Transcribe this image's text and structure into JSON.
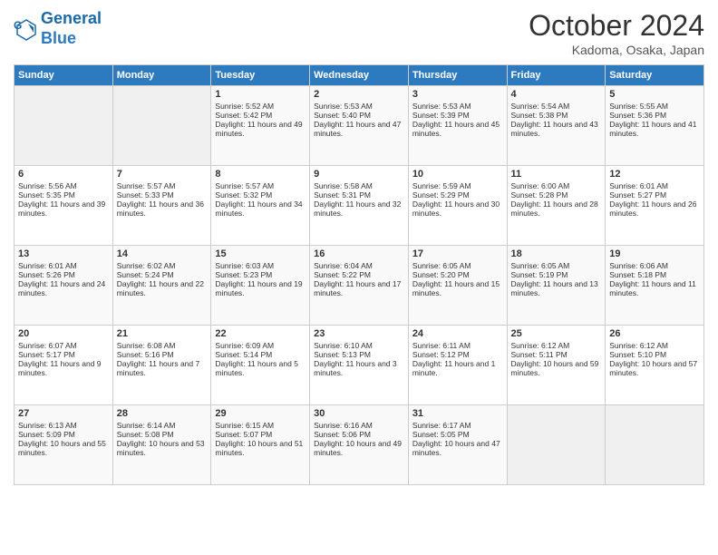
{
  "header": {
    "logo_line1": "General",
    "logo_line2": "Blue",
    "month": "October 2024",
    "location": "Kadoma, Osaka, Japan"
  },
  "weekdays": [
    "Sunday",
    "Monday",
    "Tuesday",
    "Wednesday",
    "Thursday",
    "Friday",
    "Saturday"
  ],
  "weeks": [
    [
      {
        "day": "",
        "sunrise": "",
        "sunset": "",
        "daylight": ""
      },
      {
        "day": "",
        "sunrise": "",
        "sunset": "",
        "daylight": ""
      },
      {
        "day": "1",
        "sunrise": "Sunrise: 5:52 AM",
        "sunset": "Sunset: 5:42 PM",
        "daylight": "Daylight: 11 hours and 49 minutes."
      },
      {
        "day": "2",
        "sunrise": "Sunrise: 5:53 AM",
        "sunset": "Sunset: 5:40 PM",
        "daylight": "Daylight: 11 hours and 47 minutes."
      },
      {
        "day": "3",
        "sunrise": "Sunrise: 5:53 AM",
        "sunset": "Sunset: 5:39 PM",
        "daylight": "Daylight: 11 hours and 45 minutes."
      },
      {
        "day": "4",
        "sunrise": "Sunrise: 5:54 AM",
        "sunset": "Sunset: 5:38 PM",
        "daylight": "Daylight: 11 hours and 43 minutes."
      },
      {
        "day": "5",
        "sunrise": "Sunrise: 5:55 AM",
        "sunset": "Sunset: 5:36 PM",
        "daylight": "Daylight: 11 hours and 41 minutes."
      }
    ],
    [
      {
        "day": "6",
        "sunrise": "Sunrise: 5:56 AM",
        "sunset": "Sunset: 5:35 PM",
        "daylight": "Daylight: 11 hours and 39 minutes."
      },
      {
        "day": "7",
        "sunrise": "Sunrise: 5:57 AM",
        "sunset": "Sunset: 5:33 PM",
        "daylight": "Daylight: 11 hours and 36 minutes."
      },
      {
        "day": "8",
        "sunrise": "Sunrise: 5:57 AM",
        "sunset": "Sunset: 5:32 PM",
        "daylight": "Daylight: 11 hours and 34 minutes."
      },
      {
        "day": "9",
        "sunrise": "Sunrise: 5:58 AM",
        "sunset": "Sunset: 5:31 PM",
        "daylight": "Daylight: 11 hours and 32 minutes."
      },
      {
        "day": "10",
        "sunrise": "Sunrise: 5:59 AM",
        "sunset": "Sunset: 5:29 PM",
        "daylight": "Daylight: 11 hours and 30 minutes."
      },
      {
        "day": "11",
        "sunrise": "Sunrise: 6:00 AM",
        "sunset": "Sunset: 5:28 PM",
        "daylight": "Daylight: 11 hours and 28 minutes."
      },
      {
        "day": "12",
        "sunrise": "Sunrise: 6:01 AM",
        "sunset": "Sunset: 5:27 PM",
        "daylight": "Daylight: 11 hours and 26 minutes."
      }
    ],
    [
      {
        "day": "13",
        "sunrise": "Sunrise: 6:01 AM",
        "sunset": "Sunset: 5:26 PM",
        "daylight": "Daylight: 11 hours and 24 minutes."
      },
      {
        "day": "14",
        "sunrise": "Sunrise: 6:02 AM",
        "sunset": "Sunset: 5:24 PM",
        "daylight": "Daylight: 11 hours and 22 minutes."
      },
      {
        "day": "15",
        "sunrise": "Sunrise: 6:03 AM",
        "sunset": "Sunset: 5:23 PM",
        "daylight": "Daylight: 11 hours and 19 minutes."
      },
      {
        "day": "16",
        "sunrise": "Sunrise: 6:04 AM",
        "sunset": "Sunset: 5:22 PM",
        "daylight": "Daylight: 11 hours and 17 minutes."
      },
      {
        "day": "17",
        "sunrise": "Sunrise: 6:05 AM",
        "sunset": "Sunset: 5:20 PM",
        "daylight": "Daylight: 11 hours and 15 minutes."
      },
      {
        "day": "18",
        "sunrise": "Sunrise: 6:05 AM",
        "sunset": "Sunset: 5:19 PM",
        "daylight": "Daylight: 11 hours and 13 minutes."
      },
      {
        "day": "19",
        "sunrise": "Sunrise: 6:06 AM",
        "sunset": "Sunset: 5:18 PM",
        "daylight": "Daylight: 11 hours and 11 minutes."
      }
    ],
    [
      {
        "day": "20",
        "sunrise": "Sunrise: 6:07 AM",
        "sunset": "Sunset: 5:17 PM",
        "daylight": "Daylight: 11 hours and 9 minutes."
      },
      {
        "day": "21",
        "sunrise": "Sunrise: 6:08 AM",
        "sunset": "Sunset: 5:16 PM",
        "daylight": "Daylight: 11 hours and 7 minutes."
      },
      {
        "day": "22",
        "sunrise": "Sunrise: 6:09 AM",
        "sunset": "Sunset: 5:14 PM",
        "daylight": "Daylight: 11 hours and 5 minutes."
      },
      {
        "day": "23",
        "sunrise": "Sunrise: 6:10 AM",
        "sunset": "Sunset: 5:13 PM",
        "daylight": "Daylight: 11 hours and 3 minutes."
      },
      {
        "day": "24",
        "sunrise": "Sunrise: 6:11 AM",
        "sunset": "Sunset: 5:12 PM",
        "daylight": "Daylight: 11 hours and 1 minute."
      },
      {
        "day": "25",
        "sunrise": "Sunrise: 6:12 AM",
        "sunset": "Sunset: 5:11 PM",
        "daylight": "Daylight: 10 hours and 59 minutes."
      },
      {
        "day": "26",
        "sunrise": "Sunrise: 6:12 AM",
        "sunset": "Sunset: 5:10 PM",
        "daylight": "Daylight: 10 hours and 57 minutes."
      }
    ],
    [
      {
        "day": "27",
        "sunrise": "Sunrise: 6:13 AM",
        "sunset": "Sunset: 5:09 PM",
        "daylight": "Daylight: 10 hours and 55 minutes."
      },
      {
        "day": "28",
        "sunrise": "Sunrise: 6:14 AM",
        "sunset": "Sunset: 5:08 PM",
        "daylight": "Daylight: 10 hours and 53 minutes."
      },
      {
        "day": "29",
        "sunrise": "Sunrise: 6:15 AM",
        "sunset": "Sunset: 5:07 PM",
        "daylight": "Daylight: 10 hours and 51 minutes."
      },
      {
        "day": "30",
        "sunrise": "Sunrise: 6:16 AM",
        "sunset": "Sunset: 5:06 PM",
        "daylight": "Daylight: 10 hours and 49 minutes."
      },
      {
        "day": "31",
        "sunrise": "Sunrise: 6:17 AM",
        "sunset": "Sunset: 5:05 PM",
        "daylight": "Daylight: 10 hours and 47 minutes."
      },
      {
        "day": "",
        "sunrise": "",
        "sunset": "",
        "daylight": ""
      },
      {
        "day": "",
        "sunrise": "",
        "sunset": "",
        "daylight": ""
      }
    ]
  ]
}
